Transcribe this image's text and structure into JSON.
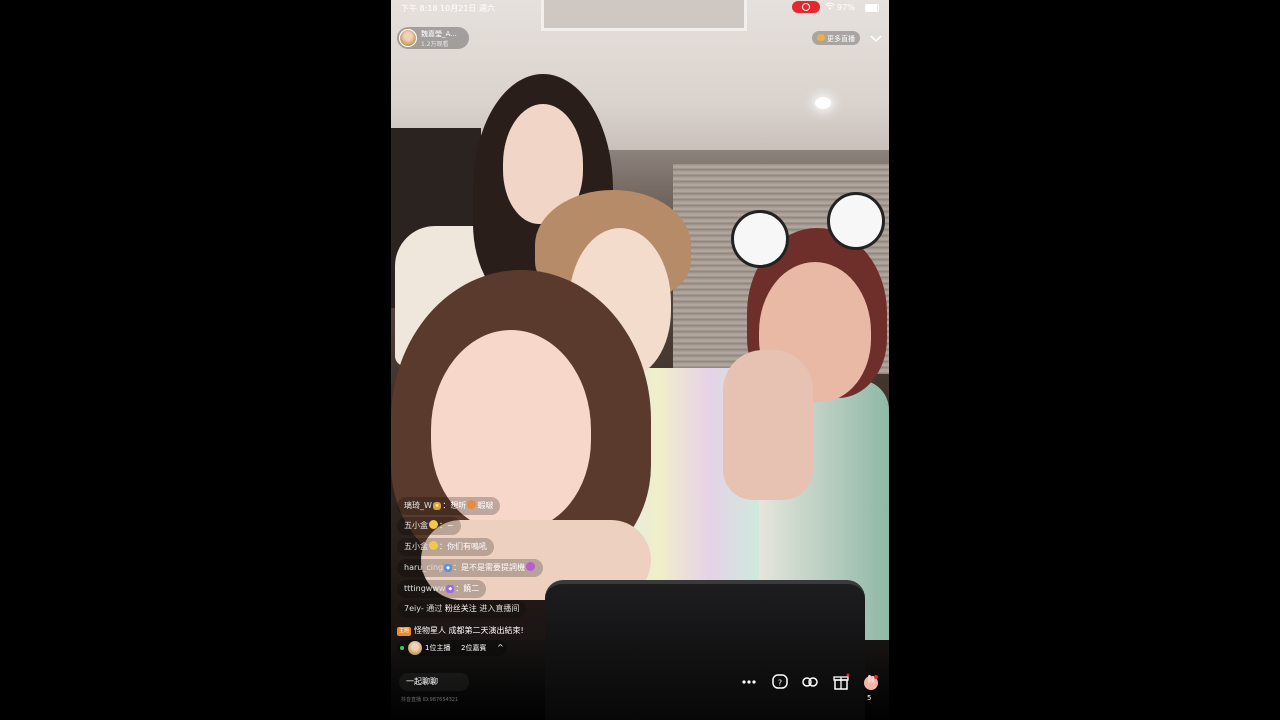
{
  "status_bar": {
    "time": "下午 8:18   10月21日 週六",
    "battery": "97%",
    "recording_icon": "screen-record-icon",
    "wifi_icon": "wifi-icon"
  },
  "host": {
    "name": "魏嘉瑩_A...",
    "viewers": "1.2万观看"
  },
  "more_live_label": "更多直播",
  "comments": [
    {
      "user": "璃琦_W",
      "text": "想听",
      "text_after": "蝦啵"
    },
    {
      "user": "五小盒",
      "text": "~"
    },
    {
      "user": "五小盒",
      "text": "你们有鳴吼"
    },
    {
      "user": "haru_cing",
      "text": "是不是需要提詞機"
    },
    {
      "user": "tttingwww",
      "text": "饒二"
    }
  ],
  "system_message": {
    "user": "7eiy-",
    "pre": "通过",
    "highlight": "粉丝关注",
    "post": "进入直播间"
  },
  "announcement": {
    "tag": "主題",
    "text": "怪物星人 成都第二天演出結束!"
  },
  "hosts_row": {
    "hosts": "1位主播",
    "guests": "2位嘉賓",
    "caret": "^"
  },
  "bottom_bar": {
    "chat_label": "一起聊聊",
    "counter": "5",
    "watermark": "抖音直播 ID:987654321"
  },
  "colors": {
    "record": "#e6282e",
    "online": "#2fd158",
    "announce_tag": "#ef8a22"
  }
}
